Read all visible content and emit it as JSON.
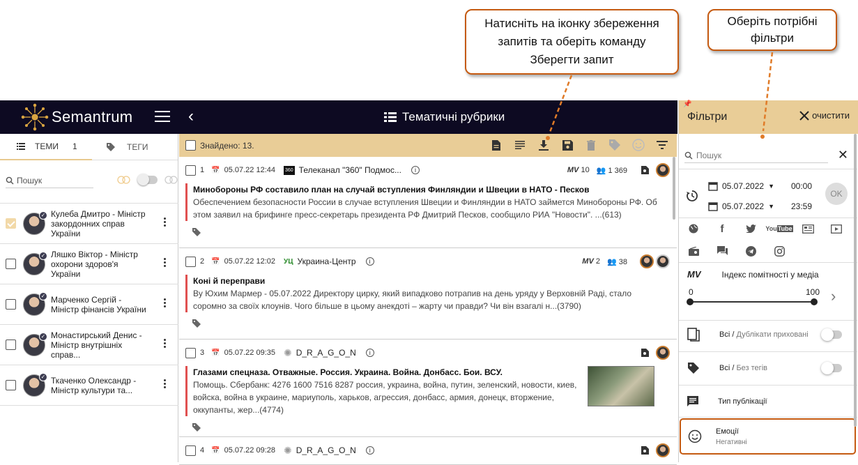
{
  "callouts": {
    "save_query": "Натисніть на іконку збереження запитів та оберіть команду Зберегти запит",
    "choose_filters": "Оберіть потрібні фільтри"
  },
  "topbar": {
    "brand": "Semantrum",
    "page_title": "Тематичні рубрики"
  },
  "left_panel": {
    "tab_themes": "ТЕМИ",
    "tab_themes_count": "1",
    "tab_tags": "ТЕГИ",
    "search_placeholder": "Пошук",
    "people": [
      {
        "name": "Кулеба Дмитро - Міністр закордонних справ України",
        "checked": true
      },
      {
        "name": "Ляшко Віктор - Міністр охорони здоров'я України",
        "checked": false
      },
      {
        "name": "Марченко Сергій - Міністр фінансів України",
        "checked": false
      },
      {
        "name": "Монастирський Денис - Міністр внутрішніх справ...",
        "checked": false
      },
      {
        "name": "Ткаченко Олександр - Міністр культури та...",
        "checked": false
      }
    ]
  },
  "main": {
    "found_label": "Знайдено: 13.",
    "articles": [
      {
        "num": "1",
        "date": "05.07.22 12:44",
        "source": "Телеканал \"360\" Подмос...",
        "mv": "10",
        "audience": "1 369",
        "title": "Минобороны РФ составило план на случай вступления Финляндии и Швеции в НАТО - Песков",
        "text": "Обеспечением безопасности России в случае вступления Швеции и Финляндии в НАТО займется Минобороны РФ. Об этом заявил на брифинге пресс-секретарь президента РФ Дмитрий Песков, сообщило РИА \"Новости\". ...(613)"
      },
      {
        "num": "2",
        "date": "05.07.22 12:02",
        "source": "Украина-Центр",
        "source_logo": "УЦ",
        "mv": "2",
        "audience": "38",
        "title": "Коні й переправи",
        "text": "Ву Юхим Мармер - 05.07.2022 Директору цирку, який випадково потрапив на день уряду у Верховній Раді, стало соромно за своїх клоунів. Чого більше в цьому анекдоті – жарту чи правди? Чи він взагалі н...(3790)"
      },
      {
        "num": "3",
        "date": "05.07.22 09:35",
        "source": "D_R_A_G_O_N",
        "title": "Глазами спецназа. Отважные. Россия. Украина. Война. Донбасс. Бои. ВСУ.",
        "text": "Помощь. Сбербанк: 4276 1600 7516 8287 россия, украина, война, путин, зеленский, новости, киев, войска, война в украине, мариуполь, харьков, агрессия, донбасс, армия, донецк, вторжение, оккупанты, жер...(4774)"
      },
      {
        "num": "4",
        "date": "05.07.22 09:28",
        "source": "D_R_A_G_O_N"
      }
    ]
  },
  "filters": {
    "title": "Фільтри",
    "clear": "очистити",
    "search_placeholder": "Пошук",
    "date_from": "05.07.2022",
    "time_from": "00:00",
    "date_to": "05.07.2022",
    "time_to": "23:59",
    "ok": "OK",
    "mv_label": "MV",
    "mv_text": "Індекс помітності у медіа",
    "mv_min": "0",
    "mv_max": "100",
    "duplicates_all": "Всі",
    "duplicates_sub": "Дублікати приховані",
    "tags_all": "Всі",
    "tags_sub": "Без тегів",
    "pub_type": "Тип публікації",
    "emotions": "Емоції",
    "emotions_value": "Негативні"
  }
}
